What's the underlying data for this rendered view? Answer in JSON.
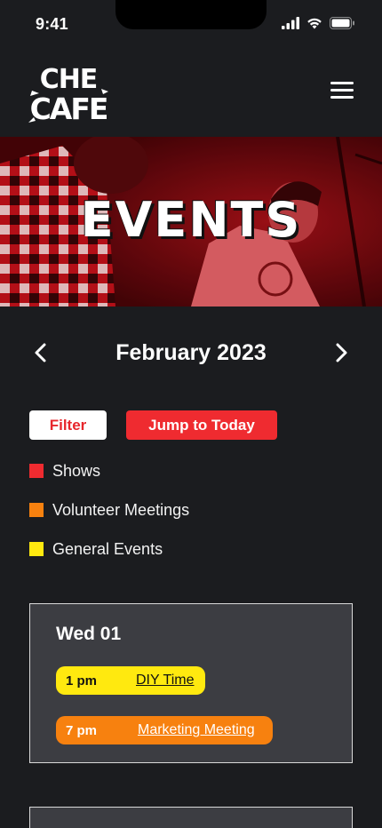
{
  "status_bar": {
    "time": "9:41"
  },
  "header": {
    "logo_line1": "CHE",
    "logo_line2": "CAFE"
  },
  "hero": {
    "title": "EVENTS"
  },
  "month_nav": {
    "label": "February 2023"
  },
  "actions": {
    "filter_label": "Filter",
    "today_label": "Jump to Today"
  },
  "legend": {
    "items": [
      {
        "label": "Shows",
        "color": "#ef2b30"
      },
      {
        "label": "Volunteer Meetings",
        "color": "#f7810f"
      },
      {
        "label": "General Events",
        "color": "#ffe90f"
      }
    ]
  },
  "days": [
    {
      "title": "Wed 01",
      "events": [
        {
          "time": "1 pm",
          "name": "DIY Time",
          "color": "#ffe90f"
        },
        {
          "time": "7 pm",
          "name": "Marketing Meeting",
          "color": "#f7810f"
        }
      ]
    }
  ]
}
